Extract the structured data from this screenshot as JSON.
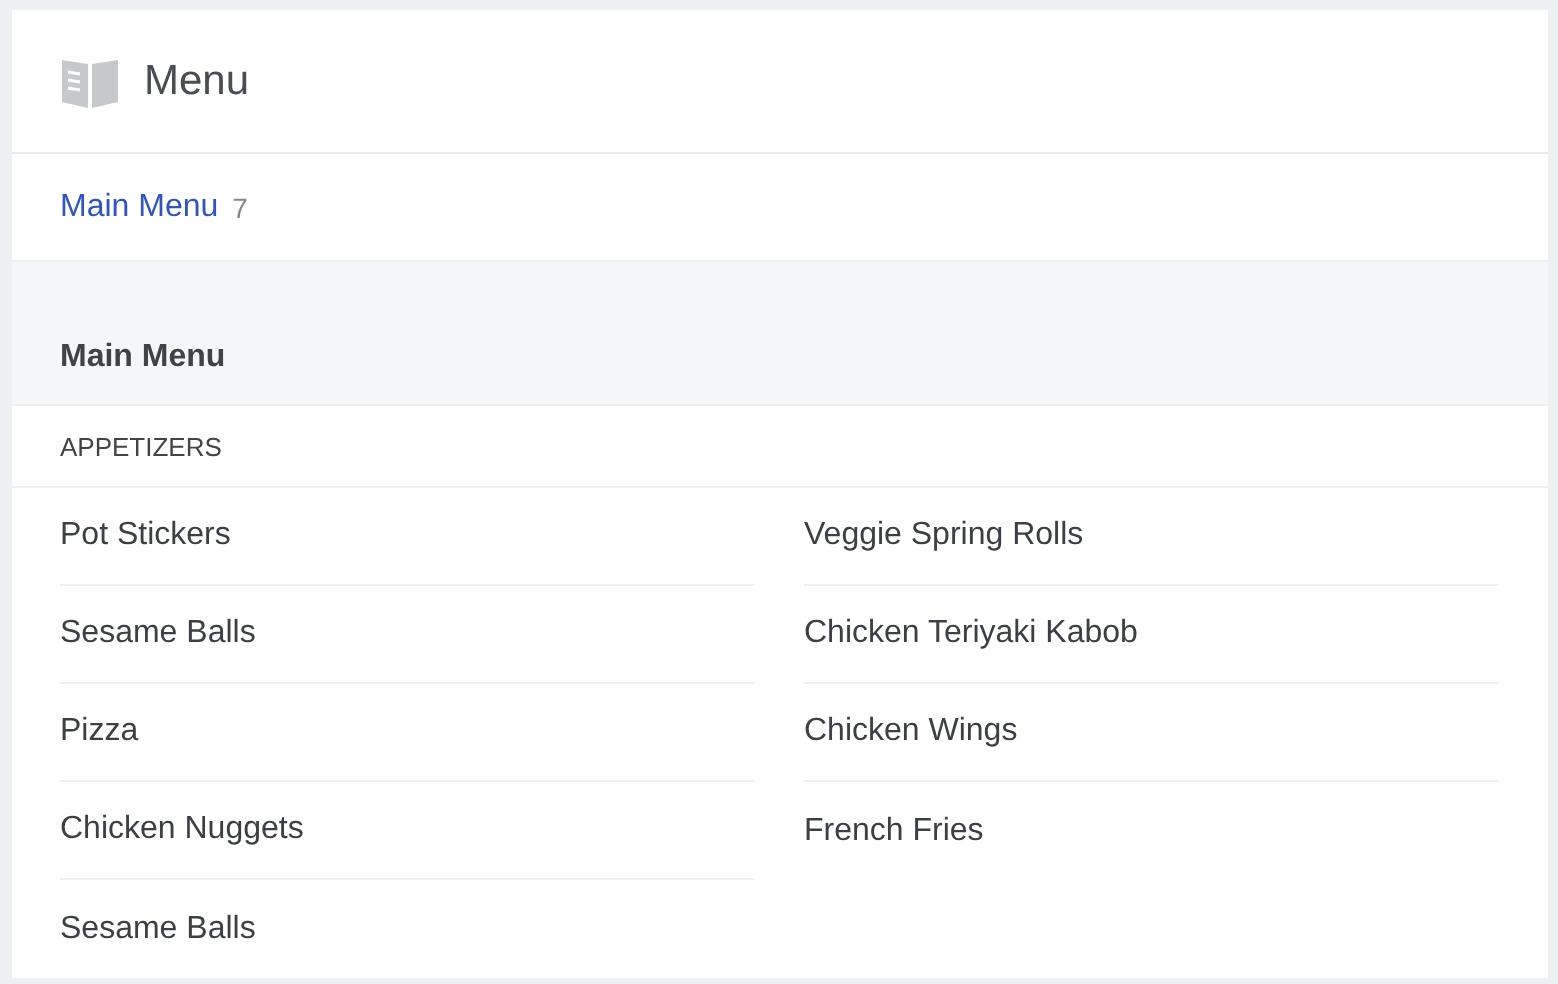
{
  "header": {
    "title": "Menu"
  },
  "tabs": [
    {
      "label": "Main Menu",
      "count": "7",
      "selected": true
    }
  ],
  "section": {
    "title": "Main Menu",
    "category": "APPETIZERS",
    "columns": [
      [
        "Pot Stickers",
        "Sesame Balls",
        "Pizza",
        "Chicken Nuggets",
        "Sesame Balls"
      ],
      [
        "Veggie Spring Rolls",
        "Chicken Teriyaki Kabob",
        "Chicken Wings",
        "French Fries"
      ]
    ]
  }
}
